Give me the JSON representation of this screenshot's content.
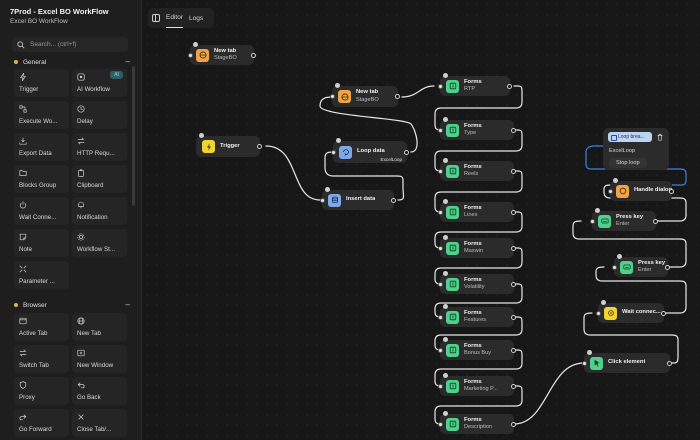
{
  "workflow": {
    "title": "7Prod - Excel BO WorkFlow",
    "subtitle": "Excel BO WorkFlow"
  },
  "search": {
    "placeholder": "Search... (ctrl+f)"
  },
  "sections": {
    "general": {
      "label": "General",
      "toggle": "–",
      "color": "#d7b84b",
      "items": [
        {
          "label": "Trigger",
          "icon": "bolt-icon"
        },
        {
          "label": "AI Workflow",
          "icon": "ai-icon",
          "badge": "AI"
        },
        {
          "label": "Execute Wo...",
          "icon": "execute-icon"
        },
        {
          "label": "Delay",
          "icon": "clock-icon"
        },
        {
          "label": "Export Data",
          "icon": "download-icon"
        },
        {
          "label": "HTTP Requ...",
          "icon": "swap-icon"
        },
        {
          "label": "Blocks Group",
          "icon": "folder-icon"
        },
        {
          "label": "Clipboard",
          "icon": "clipboard-icon"
        },
        {
          "label": "Wait Conne...",
          "icon": "power-icon"
        },
        {
          "label": "Notification",
          "icon": "bell-icon"
        },
        {
          "label": "Note",
          "icon": "note-icon"
        },
        {
          "label": "Workflow St...",
          "icon": "gear-icon"
        },
        {
          "label": "Parameter ...",
          "icon": "parameter-icon"
        }
      ]
    },
    "browser": {
      "label": "Browser",
      "toggle": "–",
      "items": [
        {
          "label": "Active Tab",
          "icon": "window-icon"
        },
        {
          "label": "New Tab",
          "icon": "globe-icon"
        },
        {
          "label": "Switch Tab",
          "icon": "switch-icon"
        },
        {
          "label": "New Window",
          "icon": "new-window-icon"
        },
        {
          "label": "Proxy",
          "icon": "shield-icon"
        },
        {
          "label": "Go Back",
          "icon": "back-arrow-icon"
        },
        {
          "label": "Go Forward",
          "icon": "forward-arrow-icon"
        },
        {
          "label": "Close Tab/...",
          "icon": "close-icon"
        }
      ]
    }
  },
  "tabs": {
    "editor": "Editor",
    "logs": "Logs"
  },
  "colors": {
    "forms_green": "#4fd18b",
    "new_tab_orange": "#f0a447",
    "trigger_yellow": "#f2d335",
    "loop_blue": "#7fa8e8",
    "selection_blue": "#3f7fe8"
  },
  "nodes": {
    "newtab1": {
      "title": "New tab",
      "sub": "StageBO"
    },
    "trigger": {
      "title": "Trigger"
    },
    "newtab2": {
      "title": "New tab",
      "sub": "StageBO"
    },
    "loopdata": {
      "title": "Loop data",
      "extra": "ExcelLoop"
    },
    "insert": {
      "title": "Insert data"
    },
    "forms": [
      {
        "title": "Forms",
        "sub": "RTP"
      },
      {
        "title": "Forms",
        "sub": "Type"
      },
      {
        "title": "Forms",
        "sub": "Reels"
      },
      {
        "title": "Forms",
        "sub": "Lines"
      },
      {
        "title": "Forms",
        "sub": "Maxwin"
      },
      {
        "title": "Forms",
        "sub": "Volatility"
      },
      {
        "title": "Forms",
        "sub": "Features"
      },
      {
        "title": "Forms",
        "sub": "Bonus Buy"
      },
      {
        "title": "Forms",
        "sub": "Marketing P..."
      },
      {
        "title": "Forms",
        "sub": "Description"
      }
    ],
    "loopbreak": {
      "chip": "Loop brea...",
      "row1": "ExcelLoop",
      "row2": "Stop loop"
    },
    "handle": {
      "title": "Handle dialog"
    },
    "press1": {
      "title": "Press key",
      "sub": "Enter"
    },
    "press2": {
      "title": "Press key",
      "sub": "Enter"
    },
    "wait": {
      "title": "Wait connec..."
    },
    "click": {
      "title": "Click element"
    }
  }
}
